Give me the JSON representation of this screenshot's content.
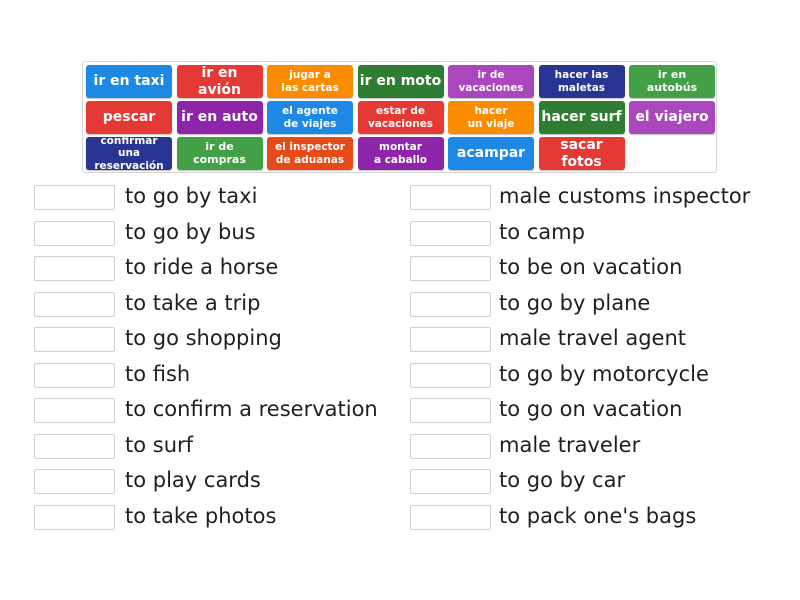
{
  "tiles": [
    {
      "text": "ir en taxi",
      "color": "#1e88e5",
      "size": "lg"
    },
    {
      "text": "ir en avión",
      "color": "#e53935",
      "size": "lg"
    },
    {
      "text": "jugar a\nlas cartas",
      "color": "#fb8c00",
      "size": "sm"
    },
    {
      "text": "ir en moto",
      "color": "#2e7d32",
      "size": "lg"
    },
    {
      "text": "ir de\nvacaciones",
      "color": "#ab47bc",
      "size": "sm"
    },
    {
      "text": "hacer las\nmaletas",
      "color": "#283593",
      "size": "sm"
    },
    {
      "text": "ir en autobús",
      "color": "#43a047",
      "size": "xs"
    },
    {
      "text": "pescar",
      "color": "#e53935",
      "size": "lg"
    },
    {
      "text": "ir en auto",
      "color": "#8e24aa",
      "size": "lg"
    },
    {
      "text": "el agente\nde viajes",
      "color": "#1e88e5",
      "size": "sm"
    },
    {
      "text": "estar de\nvacaciones",
      "color": "#e53935",
      "size": "sm"
    },
    {
      "text": "hacer\nun viaje",
      "color": "#fb8c00",
      "size": "sm"
    },
    {
      "text": "hacer surf",
      "color": "#2e7d32",
      "size": "lg"
    },
    {
      "text": "el viajero",
      "color": "#ab47bc",
      "size": "lg"
    },
    {
      "text": "confirmar una\nreservación",
      "color": "#283593",
      "size": "sm"
    },
    {
      "text": "ir de compras",
      "color": "#43a047",
      "size": "xs"
    },
    {
      "text": "el inspector\nde aduanas",
      "color": "#e64a19",
      "size": "sm"
    },
    {
      "text": "montar\na caballo",
      "color": "#8e24aa",
      "size": "sm"
    },
    {
      "text": "acampar",
      "color": "#1e88e5",
      "size": "lg"
    },
    {
      "text": "sacar fotos",
      "color": "#e53935",
      "size": "lg"
    }
  ],
  "left_prompts": [
    "to go by taxi",
    "to go by bus",
    "to ride a horse",
    "to take a trip",
    "to go shopping",
    "to fish",
    "to confirm a reservation",
    "to surf",
    "to play cards",
    "to take photos"
  ],
  "right_prompts": [
    "male customs inspector",
    "to camp",
    "to be on vacation",
    "to go by plane",
    "male travel agent",
    "to go by motorcycle",
    "to go on vacation",
    "male traveler",
    "to go by car",
    "to pack one's bags"
  ]
}
